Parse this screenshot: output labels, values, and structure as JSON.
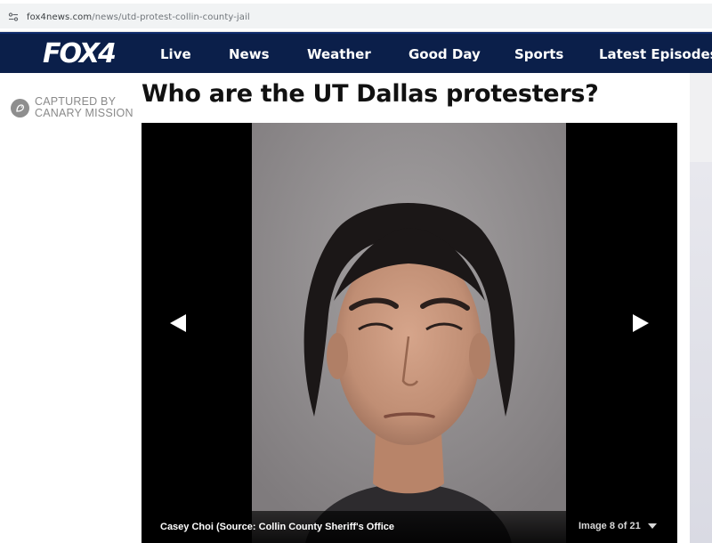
{
  "browser": {
    "url_domain": "fox4news.com",
    "url_path": "/news/utd-protest-collin-county-jail",
    "site_icon": "site-settings-icon"
  },
  "nav": {
    "logo_text": "FOX4",
    "items": [
      "Live",
      "News",
      "Weather",
      "Good Day",
      "Sports",
      "Latest Episodes"
    ],
    "background": "#0b1f4a"
  },
  "badge": {
    "line1": "CAPTURED BY",
    "line2": "CANARY MISSION",
    "icon": "canary-bird-icon"
  },
  "article": {
    "headline": "Who are the UT Dallas protesters?"
  },
  "gallery": {
    "caption": "Casey Choi (Source: Collin County Sheriff's Office",
    "counter": "Image 8 of 21",
    "prev_icon": "arrow-left-icon",
    "next_icon": "arrow-right-icon",
    "expand_icon": "caret-down-icon"
  }
}
